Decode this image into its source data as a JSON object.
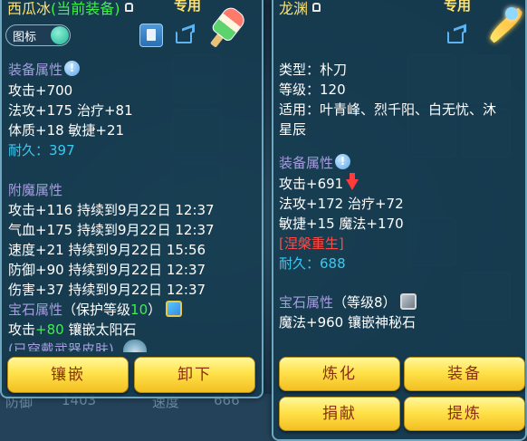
{
  "left": {
    "title_name": "西瓜冰",
    "title_status": "(当前装备)",
    "exclusive": "专用",
    "toggle_label": "图标",
    "attr_header": "装备属性",
    "attrs": [
      "攻击+700",
      "法攻+175 治疗+81",
      "体质+18 敏捷+21"
    ],
    "durability_label": "耐久：",
    "durability_value": "397",
    "enchant_header": "附魔属性",
    "enchants": [
      "攻击+116 持续到9月22日 12:37",
      "气血+175 持续到9月22日 12:37",
      "速度+21 持续到9月22日 15:56",
      "防御+90 持续到9月22日 12:37",
      "伤害+37 持续到9月22日 12:37"
    ],
    "gem_header": "宝石属性",
    "gem_protect_prefix": "（保护等级",
    "gem_protect_level": "10",
    "gem_protect_suffix": "）",
    "gem_line_prefix": "攻击",
    "gem_line_value": "+80",
    "gem_line_suffix": " 镶嵌太阳石",
    "cut_line": "(已穿戴武器皮肤)",
    "buttons": [
      "镶嵌",
      "卸下"
    ]
  },
  "background": {
    "def_label": "防御",
    "def_value": "1403",
    "speed_label": "速度",
    "speed_value": "666"
  },
  "right": {
    "title_name": "龙渊",
    "exclusive": "专用",
    "type_line": "类型：朴刀",
    "level_line": "等级：120",
    "suit_line1": "适用：叶青峰、烈千阳、白无忧、沐",
    "suit_line2": "星辰",
    "attr_header": "装备属性",
    "attrs": [
      "攻击+691",
      "法攻+172 治疗+72",
      "敏捷+15 魔法+170"
    ],
    "rebirth": "[涅槃重生]",
    "durability_label": "耐久：",
    "durability_value": "688",
    "gem_header": "宝石属性",
    "gem_level": "（等级8）",
    "gem_line": "魔法+960 镶嵌神秘石",
    "buttons": [
      "炼化",
      "装备",
      "捐献",
      "提炼"
    ]
  }
}
